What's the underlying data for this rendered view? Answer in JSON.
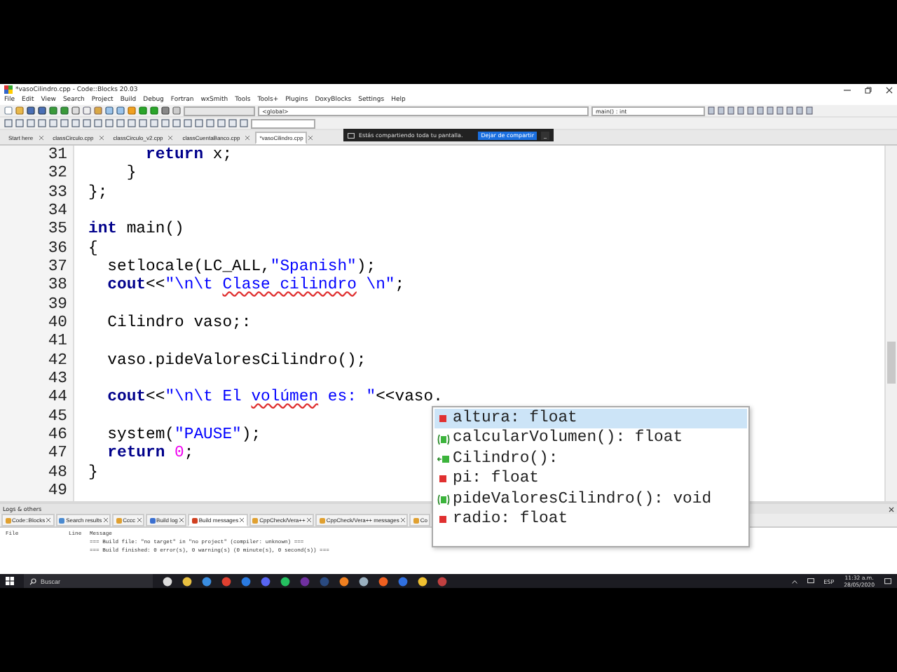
{
  "window": {
    "title": "*vasoCilindro.cpp - Code::Blocks 20.03"
  },
  "menu": [
    "File",
    "Edit",
    "View",
    "Search",
    "Project",
    "Build",
    "Debug",
    "Fortran",
    "wxSmith",
    "Tools",
    "Tools+",
    "Plugins",
    "DoxyBlocks",
    "Settings",
    "Help"
  ],
  "scope_dropdowns": [
    "<global>",
    "main() : int"
  ],
  "editor_tabs": [
    {
      "label": "Start here",
      "selected": false
    },
    {
      "label": "classCirculo.cpp",
      "selected": false
    },
    {
      "label": "classCirculo_v2.cpp",
      "selected": false
    },
    {
      "label": "classCuentaBanco.cpp",
      "selected": false
    },
    {
      "label": "*vasoCilindro.cpp",
      "selected": true
    }
  ],
  "share_banner": {
    "message": "Estás compartiendo toda tu pantalla.",
    "button": "Dejar de compartir",
    "minimize": "_"
  },
  "code_lines": [
    {
      "number": "31",
      "tokens": [
        {
          "text": "      return",
          "kind": "keyword"
        },
        {
          "text": " x;",
          "kind": "text"
        }
      ]
    },
    {
      "number": "32",
      "tokens": [
        {
          "text": "    }",
          "kind": "text"
        }
      ]
    },
    {
      "number": "33",
      "tokens": [
        {
          "text": "};",
          "kind": "text"
        }
      ]
    },
    {
      "number": "34"
    },
    {
      "number": "35",
      "tokens": [
        {
          "text": "int",
          "kind": "keyword"
        },
        {
          "text": " main()",
          "kind": "text"
        }
      ]
    },
    {
      "number": "36",
      "tokens": [
        {
          "text": "{",
          "kind": "text"
        }
      ]
    },
    {
      "number": "37",
      "tokens": [
        {
          "text": "  setlocale(LC_ALL,",
          "kind": "text"
        },
        {
          "text": "\"Spanish\"",
          "kind": "string"
        },
        {
          "text": ");",
          "kind": "text"
        }
      ]
    },
    {
      "number": "38",
      "tokens": [
        {
          "text": "  cout",
          "kind": "keyword"
        },
        {
          "text": "<<",
          "kind": "text"
        },
        {
          "text": "\"\\n\\t ",
          "kind": "string"
        },
        {
          "text": "Clase cilindro",
          "kind": "misspelled"
        },
        {
          "text": " \\n\"",
          "kind": "string"
        },
        {
          "text": ";",
          "kind": "text"
        }
      ]
    },
    {
      "number": "39"
    },
    {
      "number": "40",
      "tokens": [
        {
          "text": "  Cilindro vaso;:",
          "kind": "text"
        }
      ]
    },
    {
      "number": "41"
    },
    {
      "number": "42",
      "tokens": [
        {
          "text": "  vaso.pideValoresCilindro();",
          "kind": "text"
        }
      ]
    },
    {
      "number": "43"
    },
    {
      "number": "44",
      "tokens": [
        {
          "text": "  cout",
          "kind": "keyword"
        },
        {
          "text": "<<",
          "kind": "text"
        },
        {
          "text": "\"\\n\\t El ",
          "kind": "string"
        },
        {
          "text": "volúmen",
          "kind": "misspelled"
        },
        {
          "text": " es: \"",
          "kind": "string"
        },
        {
          "text": "<<vaso.",
          "kind": "text"
        }
      ]
    },
    {
      "number": "45"
    },
    {
      "number": "46",
      "tokens": [
        {
          "text": "  system(",
          "kind": "text"
        },
        {
          "text": "\"PAUSE\"",
          "kind": "string"
        },
        {
          "text": ");",
          "kind": "text"
        }
      ]
    },
    {
      "number": "47",
      "tokens": [
        {
          "text": "  return",
          "kind": "keyword"
        },
        {
          "text": " 0",
          "kind": "number"
        },
        {
          "text": ";",
          "kind": "text"
        }
      ]
    },
    {
      "number": "48",
      "tokens": [
        {
          "text": "}",
          "kind": "text"
        }
      ]
    },
    {
      "number": "49"
    }
  ],
  "autocomplete": [
    {
      "label": "altura: float",
      "kind": "variable",
      "selected": true
    },
    {
      "label": "calcularVolumen(): float",
      "kind": "method",
      "selected": false
    },
    {
      "label": "Cilindro():",
      "kind": "constructor",
      "selected": false
    },
    {
      "label": "pi: float",
      "kind": "variable",
      "selected": false
    },
    {
      "label": "pideValoresCilindro(): void",
      "kind": "method",
      "selected": false
    },
    {
      "label": "radio: float",
      "kind": "variable",
      "selected": false
    }
  ],
  "logs": {
    "title": "Logs & others",
    "tabs": [
      {
        "label": "Code::Blocks",
        "selected": false
      },
      {
        "label": "Search results",
        "selected": false
      },
      {
        "label": "Cccc",
        "selected": false
      },
      {
        "label": "Build log",
        "selected": false
      },
      {
        "label": "Build messages",
        "selected": true
      },
      {
        "label": "CppCheck/Vera++",
        "selected": false
      },
      {
        "label": "CppCheck/Vera++ messages",
        "selected": false
      },
      {
        "label": "Co",
        "selected": false
      }
    ],
    "columns": [
      "File",
      "Line",
      "Message"
    ],
    "rows": [
      {
        "file": "",
        "line": "",
        "message": "=== Build file: \"no target\" in \"no project\" (compiler: unknown) ==="
      },
      {
        "file": "",
        "line": "",
        "message": "=== Build finished: 0 error(s), 0 warning(s) (0 minute(s), 0 second(s)) ==="
      }
    ]
  },
  "taskbar": {
    "search_placeholder": "Buscar",
    "language": "ESP",
    "time": "11:32 a.m.",
    "date": "28/05/2020"
  }
}
